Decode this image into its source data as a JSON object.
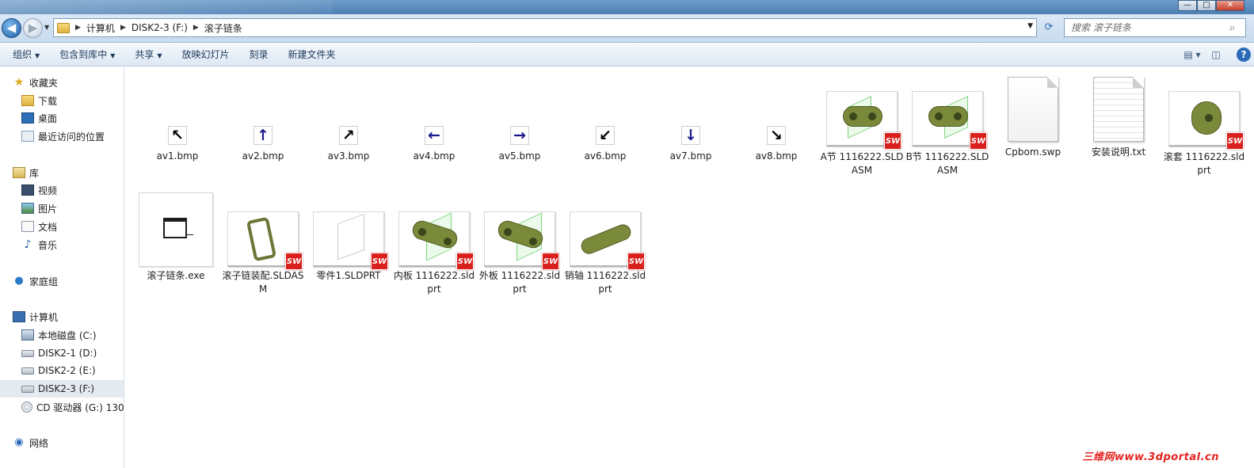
{
  "window": {
    "minimize": "—",
    "maximize": "□",
    "close": "✕"
  },
  "address": {
    "crumbs": [
      "计算机",
      "DISK2-3 (F:)",
      "滚子链条"
    ],
    "search_placeholder": "搜索 滚子链条"
  },
  "toolbar": {
    "organize": "组织",
    "include_library": "包含到库中",
    "share": "共享",
    "slideshow": "放映幻灯片",
    "burn": "刻录",
    "new_folder": "新建文件夹",
    "help": "?"
  },
  "nav": {
    "favorites": "收藏夹",
    "downloads": "下载",
    "desktop": "桌面",
    "recent": "最近访问的位置",
    "libraries": "库",
    "videos": "视频",
    "pictures": "图片",
    "documents": "文档",
    "music": "音乐",
    "homegroup": "家庭组",
    "computer": "计算机",
    "drive_c": "本地磁盘 (C:)",
    "drive_d": "DISK2-1 (D:)",
    "drive_e": "DISK2-2 (E:)",
    "drive_f": "DISK2-3 (F:)",
    "drive_g": "CD 驱动器 (G:) 130:",
    "network": "网络"
  },
  "files": {
    "av1": "av1.bmp",
    "av2": "av2.bmp",
    "av3": "av3.bmp",
    "av4": "av4.bmp",
    "av5": "av5.bmp",
    "av6": "av6.bmp",
    "av7": "av7.bmp",
    "av8": "av8.bmp",
    "a_link": "A节 1116222.SLDASM",
    "b_link": "B节 1116222.SLDASM",
    "cpbom": "Cpbom.swp",
    "install": "安装说明.txt",
    "roller": "滚套 1116222.sldprt",
    "exe": "滚子链条.exe",
    "assembly": "滚子链装配.SLDASM",
    "part1": "零件1.SLDPRT",
    "inner": "内板 1116222.sldprt",
    "outer": "外板 1116222.sldprt",
    "pin": "销轴 1116222.sldprt"
  },
  "sw_badge": "SW",
  "watermark": "三维网www.3dportal.cn"
}
